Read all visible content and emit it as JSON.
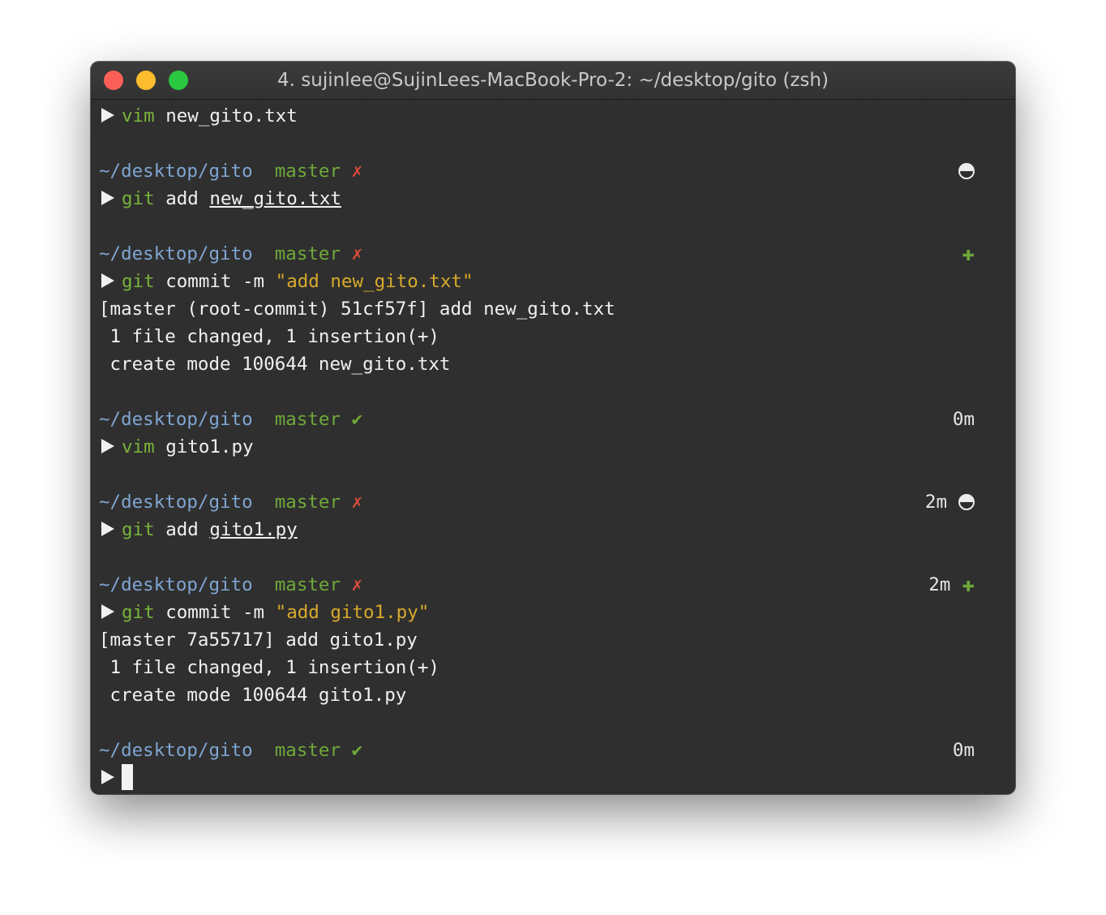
{
  "window": {
    "title": "4. sujinlee@SujinLees-MacBook-Pro-2: ~/desktop/gito (zsh)"
  },
  "prompt": {
    "path": "~/desktop/gito",
    "branch": "master",
    "dirty_mark": "✗",
    "clean_mark": "✔"
  },
  "lines": {
    "l1": {
      "cmd": "vim",
      "arg": "new_gito.txt"
    },
    "l2": {
      "cmd": "git",
      "sub": "add",
      "arg": "new_gito.txt"
    },
    "l3": {
      "cmd": "git",
      "sub": "commit -m",
      "str": "\"add new_gito.txt\""
    },
    "l3_out": [
      "[master (root-commit) 51cf57f] add new_gito.txt",
      " 1 file changed, 1 insertion(+)",
      " create mode 100644 new_gito.txt"
    ],
    "l4": {
      "time": "0m",
      "cmd": "vim",
      "arg": "gito1.py"
    },
    "l5": {
      "time": "2m",
      "cmd": "git",
      "sub": "add",
      "arg": "gito1.py"
    },
    "l6": {
      "time": "2m",
      "cmd": "git",
      "sub": "commit -m",
      "str": "\"add gito1.py\""
    },
    "l6_out": [
      "[master 7a55717] add gito1.py",
      " 1 file changed, 1 insertion(+)",
      " create mode 100644 gito1.py"
    ],
    "l7": {
      "time": "0m"
    }
  },
  "icons": {
    "half": "half-circle-icon",
    "plus": "plus-icon"
  }
}
